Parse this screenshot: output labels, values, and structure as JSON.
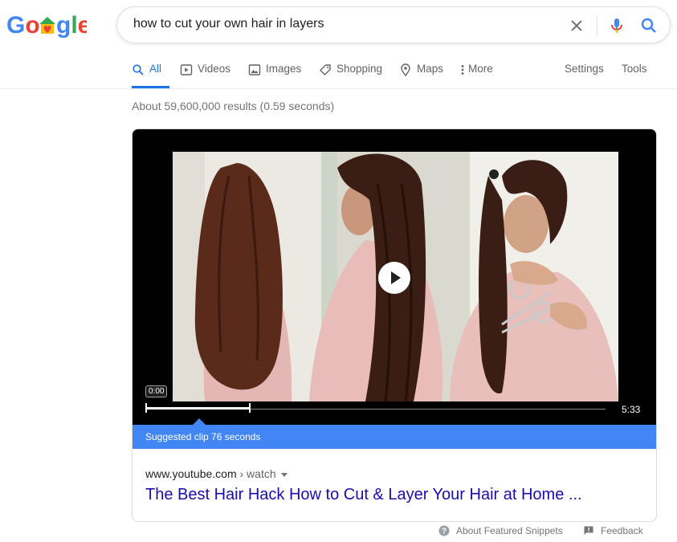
{
  "logo": {
    "text": "Google"
  },
  "search": {
    "query": "how to cut your own hair in layers"
  },
  "icons": {
    "clear": "close-icon",
    "voice": "microphone-icon",
    "search": "search-icon"
  },
  "tabs": [
    {
      "label": "All",
      "icon": "search-icon",
      "active": true
    },
    {
      "label": "Videos",
      "icon": "play-square-icon"
    },
    {
      "label": "Images",
      "icon": "image-icon"
    },
    {
      "label": "Shopping",
      "icon": "tag-icon"
    },
    {
      "label": "Maps",
      "icon": "map-pin-icon"
    },
    {
      "label": "More",
      "icon": "vertical-dots-icon"
    }
  ],
  "tools": {
    "settings": "Settings",
    "tools": "Tools"
  },
  "stats": "About 59,600,000 results (0.59 seconds)",
  "video": {
    "time_start": "0:00",
    "duration": "5:33",
    "suggested_clip": "Suggested clip 76 seconds"
  },
  "result": {
    "site": "www.youtube.com",
    "crumb": " › watch",
    "title": "The Best Hair Hack How to Cut & Layer Your Hair at Home ..."
  },
  "footer": {
    "about": "About Featured Snippets",
    "feedback": "Feedback"
  },
  "colors": {
    "accent": "#1a73e8",
    "clip_bar": "#4285f4",
    "link": "#1a0dab"
  }
}
